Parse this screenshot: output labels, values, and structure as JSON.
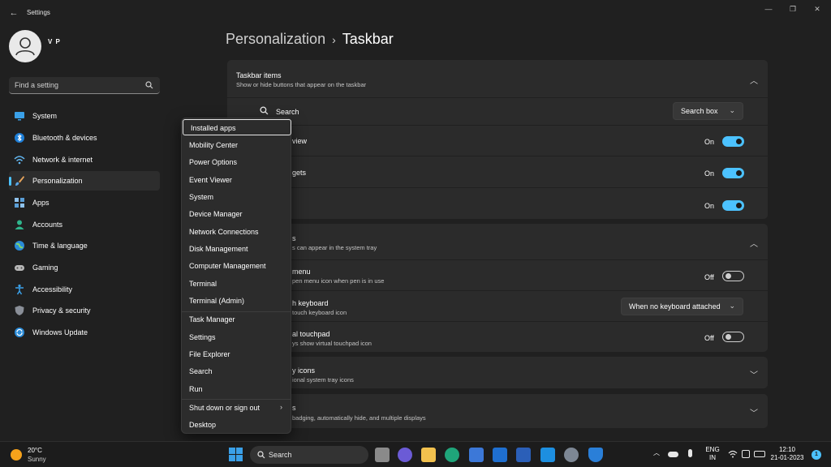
{
  "window": {
    "title": "Settings",
    "minimize_glyph": "—",
    "restore_glyph": "❐",
    "close_glyph": "✕"
  },
  "user": {
    "name": "V P"
  },
  "search": {
    "placeholder": "Find a setting"
  },
  "sidebar": {
    "items": [
      {
        "label": "System",
        "icon": "monitor-icon"
      },
      {
        "label": "Bluetooth & devices",
        "icon": "bluetooth-icon"
      },
      {
        "label": "Network & internet",
        "icon": "wifi-icon"
      },
      {
        "label": "Personalization",
        "icon": "brush-icon",
        "active": true
      },
      {
        "label": "Apps",
        "icon": "apps-icon"
      },
      {
        "label": "Accounts",
        "icon": "person-icon"
      },
      {
        "label": "Time & language",
        "icon": "globe-icon"
      },
      {
        "label": "Gaming",
        "icon": "gamepad-icon"
      },
      {
        "label": "Accessibility",
        "icon": "accessibility-icon"
      },
      {
        "label": "Privacy & security",
        "icon": "shield-icon"
      },
      {
        "label": "Windows Update",
        "icon": "update-icon"
      }
    ]
  },
  "header": {
    "parent": "Personalization",
    "separator": "›",
    "title": "Taskbar"
  },
  "taskbar_items": {
    "title": "Taskbar items",
    "subtitle": "Show or hide buttons that appear on the taskbar",
    "search_label": "Search",
    "search_value": "Search box",
    "rows": [
      {
        "label": "view",
        "state": "On"
      },
      {
        "label": "gets",
        "state": "On"
      },
      {
        "label": "",
        "state": "On"
      }
    ]
  },
  "corner_icons": {
    "title": "s",
    "subtitle": "s can appear in the system tray",
    "pen_title": "menu",
    "pen_sub": "pen menu icon when pen is in use",
    "pen_state": "Off",
    "kb_title": "h keyboard",
    "kb_sub": "touch keyboard icon",
    "kb_value": "When no keyboard attached",
    "tp_title": "al touchpad",
    "tp_sub": "ys show virtual touchpad icon",
    "tp_state": "Off"
  },
  "overflow": {
    "title": "y icons",
    "subtitle": "ional system tray icons"
  },
  "behaviors": {
    "title": "s",
    "subtitle": "badging, automatically hide, and multiple displays"
  },
  "context_menu": {
    "items": [
      "Installed apps",
      "Mobility Center",
      "Power Options",
      "Event Viewer",
      "System",
      "Device Manager",
      "Network Connections",
      "Disk Management",
      "Computer Management",
      "Terminal",
      "Terminal (Admin)",
      "Task Manager",
      "Settings",
      "File Explorer",
      "Search",
      "Run",
      "Shut down or sign out",
      "Desktop"
    ],
    "submenu_arrow": "›"
  },
  "taskbar": {
    "weather_temp": "20°C",
    "weather_cond": "Sunny",
    "search_label": "Search",
    "lang_top": "ENG",
    "lang_bottom": "IN",
    "time": "12:10",
    "date": "21-01-2023",
    "notifications": "1",
    "colors": {
      "accent": "#4cc2ff",
      "weather": "#f7a21b"
    }
  }
}
